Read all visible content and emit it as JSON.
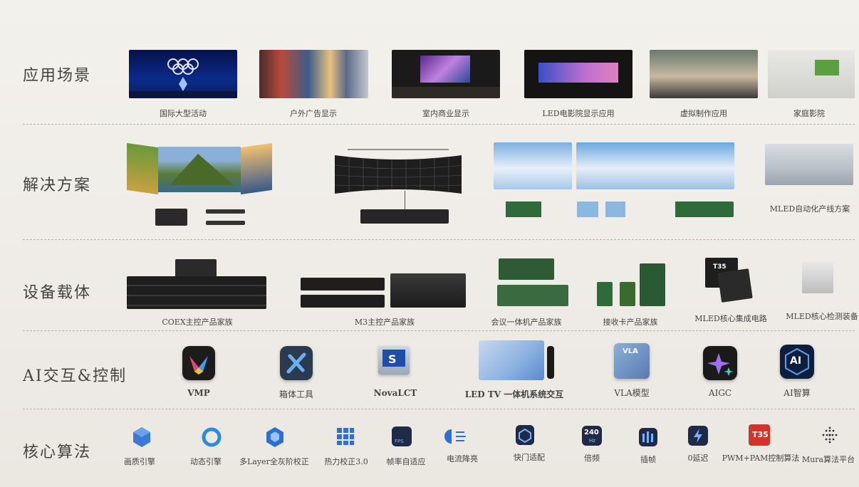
{
  "rows": {
    "scenes": {
      "label": "应用场景",
      "items": [
        "国际大型活动",
        "户外广告显示",
        "室内商业显示",
        "LED电影院显示应用",
        "虚拟制作应用",
        "家庭影院"
      ]
    },
    "solutions": {
      "label": "解决方案",
      "items": [
        "MLED自动化产线方案"
      ]
    },
    "devices": {
      "label": "设备载体",
      "items": [
        "COEX主控产品家族",
        "M3主控产品家族",
        "会议一体机产品家族",
        "接收卡产品家族",
        "MLED核心集成电路",
        "MLED核心检测装备"
      ]
    },
    "ai": {
      "label": "AI交互&控制",
      "items": [
        "VMP",
        "箱体工具",
        "NovaLCT",
        "LED TV 一体机系统交互",
        "VLA模型",
        "AIGC",
        "AI智算"
      ]
    },
    "algorithms": {
      "label": "核心算法",
      "items": [
        "画质引擎",
        "动态引擎",
        "多Layer全灰阶校正",
        "热力校正3.0",
        "帧率自适应",
        "电流降亮",
        "快门适配",
        "倍频",
        "插帧",
        "0延迟",
        "PWM+PAM控制算法",
        "Mura算法平台"
      ]
    }
  },
  "icon_text": {
    "vla": "VLA",
    "ai_badge": "AI",
    "hz": "240",
    "hz_unit": "Hz",
    "t3s": "T35",
    "chip": "T35",
    "fps": "FPS"
  },
  "colors": {
    "vmp_bg": "#1c1c1c",
    "tool_bg": "#2b3b4f",
    "aigc_bg": "#1a1a1a",
    "ai_bg": "#0f1e3c",
    "algo_blue": "#2c6fd6",
    "t3s_red": "#d2332a"
  }
}
